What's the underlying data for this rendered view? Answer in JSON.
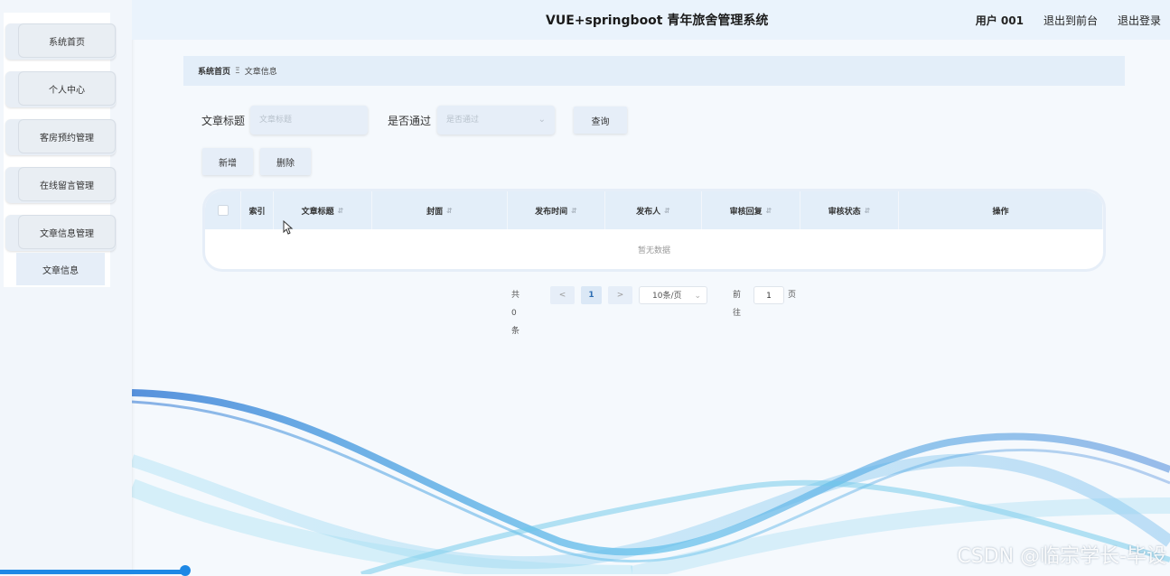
{
  "header": {
    "title": "VUE+springboot 青年旅舍管理系统",
    "user": "用户 001",
    "to_front": "退出到前台",
    "logout": "退出登录"
  },
  "sidebar": {
    "items": [
      {
        "label": "系统首页"
      },
      {
        "label": "个人中心"
      },
      {
        "label": "客房预约管理"
      },
      {
        "label": "在线留言管理"
      },
      {
        "label": "文章信息管理"
      }
    ],
    "submenu": {
      "label": "文章信息"
    }
  },
  "breadcrumb": {
    "home": "系统首页",
    "separator": "Ξ",
    "current": "文章信息"
  },
  "search": {
    "title_label": "文章标题",
    "title_placeholder": "文章标题",
    "pass_label": "是否通过",
    "pass_placeholder": "是否通过",
    "query_button": "查询"
  },
  "actions": {
    "add": "新增",
    "delete": "删除"
  },
  "table": {
    "columns": [
      "索引",
      "文章标题",
      "封面",
      "发布时间",
      "发布人",
      "审核回复",
      "审核状态",
      "操作"
    ],
    "empty_text": "暂无数据"
  },
  "pagination": {
    "total_text": "共 0 条",
    "prev": "<",
    "current_page": "1",
    "next": ">",
    "page_size": "10条/页",
    "goto_label": "前往",
    "goto_value": "1",
    "page_unit": "页"
  },
  "watermark": "CSDN @临宗学长-毕设",
  "colors": {
    "accent": "#1e88e5",
    "panel": "#e6eef8",
    "header_bg": "#eaf3fc"
  }
}
